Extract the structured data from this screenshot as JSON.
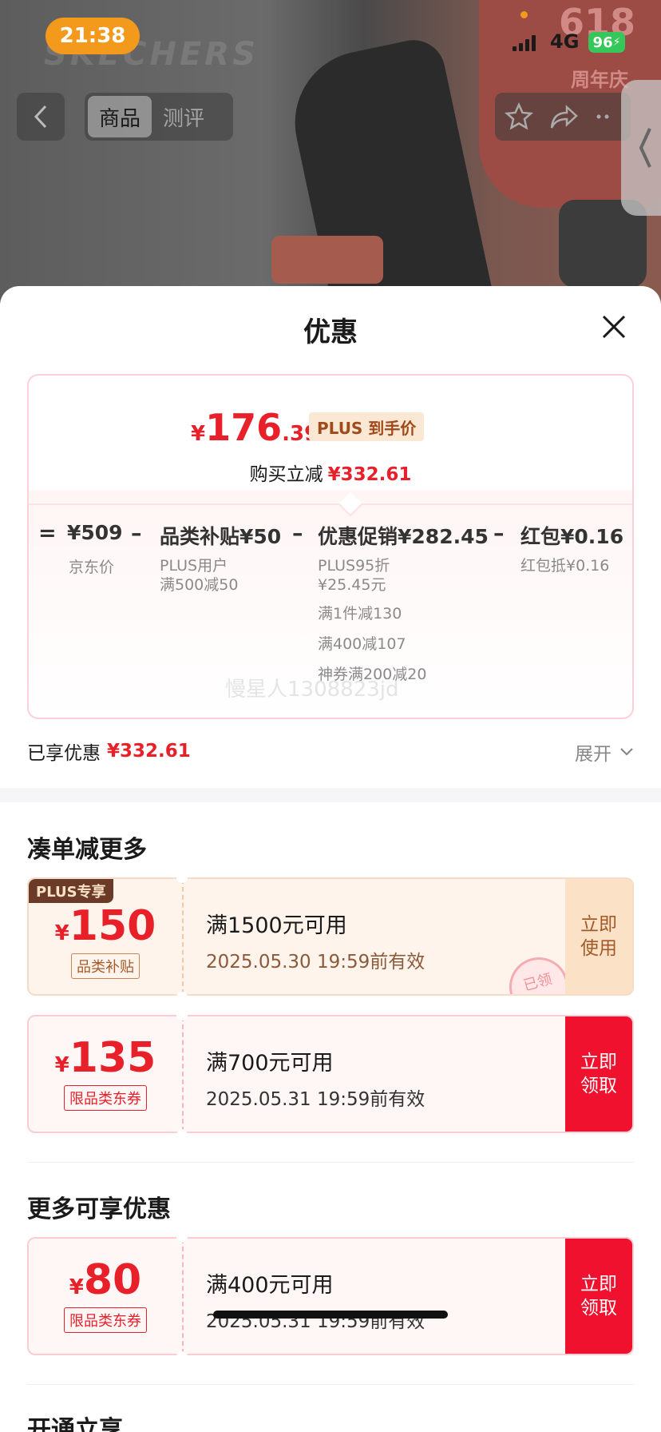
{
  "status_bar": {
    "time": "21:38",
    "network": "4G",
    "battery": "96"
  },
  "backdrop": {
    "brand_text": "SKECHERS",
    "promo_number": "618",
    "promo_text": "周年庆"
  },
  "nav": {
    "tabs": [
      "商品",
      "测评"
    ],
    "active_tab": "商品"
  },
  "sheet": {
    "title": "优惠",
    "price": {
      "currency": "¥",
      "integer": "176",
      "decimal": ".39",
      "badge": "PLUS 到手价"
    },
    "instant_reduce": {
      "label": "购买立减",
      "amount": "¥332.61"
    },
    "breakdown": {
      "eq": "=",
      "jd_price": {
        "value": "¥509",
        "label": "京东价"
      },
      "category_subsidy": {
        "title": "品类补贴",
        "value": "¥50",
        "details": [
          "PLUS用户",
          "满500减50"
        ]
      },
      "promo": {
        "title": "优惠促销",
        "value": "¥282.45",
        "details": [
          "PLUS95折",
          "¥25.45元",
          "满1件减130",
          "满400减107",
          "神券满200减20"
        ]
      },
      "red_packet": {
        "title": "红包",
        "value": "¥0.16",
        "details": [
          "红包抵¥0.16"
        ]
      }
    },
    "watermark": "慢星人1308823jd",
    "enjoyed": {
      "label": "已享优惠",
      "amount": "¥332.61",
      "expand": "展开"
    },
    "section_more": "凑单减更多",
    "coupons": [
      {
        "exclusive": "PLUS专享",
        "currency": "¥",
        "amount": "150",
        "tag": "品类补贴",
        "condition": "满1500元可用",
        "expiry": "2025.05.30 19:59前有效",
        "button": "立即\n使用",
        "stamp": "已领"
      },
      {
        "currency": "¥",
        "amount": "135",
        "tag": "限品类东券",
        "condition": "满700元可用",
        "expiry": "2025.05.31 19:59前有效",
        "button": "立即\n领取"
      }
    ],
    "section_extra": "更多可享优惠",
    "extra_coupons": [
      {
        "currency": "¥",
        "amount": "80",
        "tag": "限品类东券",
        "condition": "满400元可用",
        "expiry": "2025.05.31 19:59前有效",
        "button": "立即\n领取"
      }
    ],
    "next_section_cut": "开通立享"
  },
  "colors": {
    "price_red": "#e8202a",
    "button_red": "#f0112e",
    "plus_brown": "#6b3b28",
    "time_pill": "#f39a1d"
  }
}
